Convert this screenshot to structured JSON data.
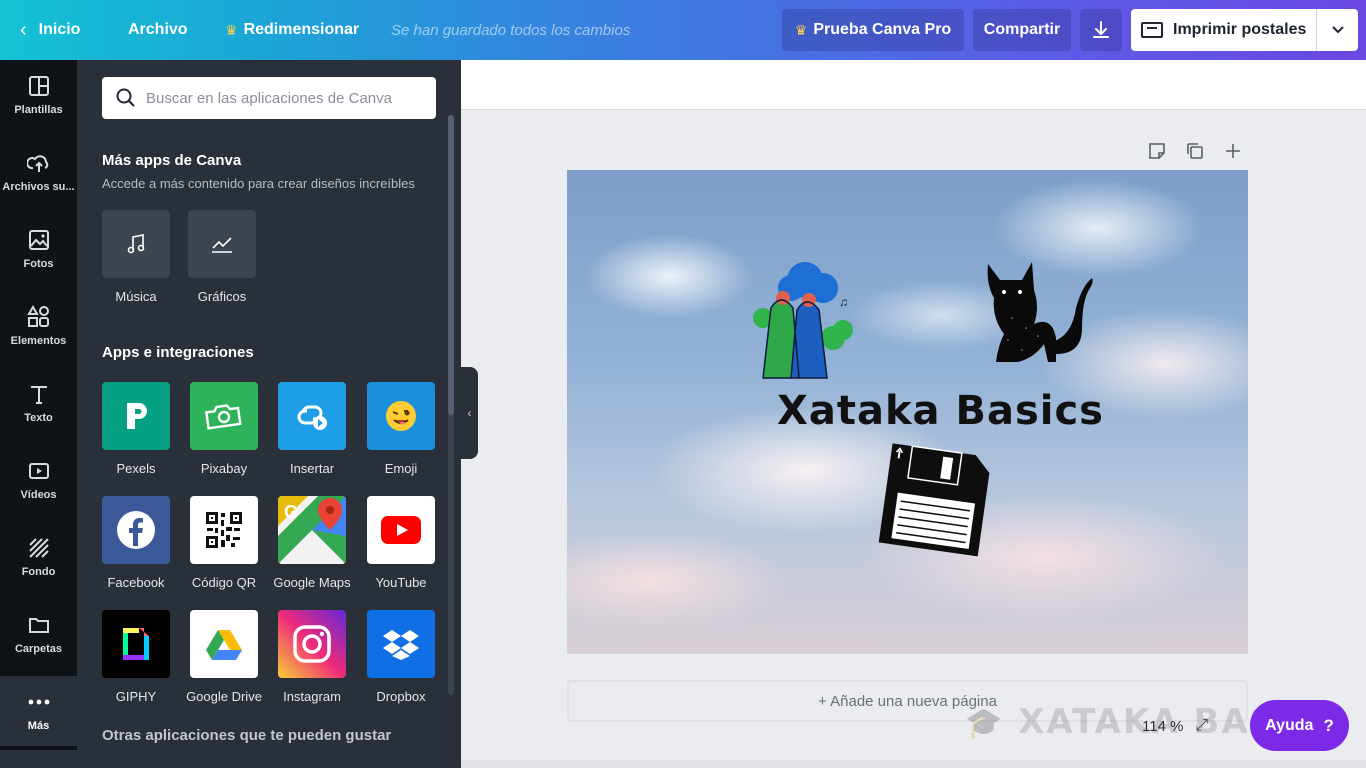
{
  "topbar": {
    "back_label": "Inicio",
    "file_label": "Archivo",
    "resize_label": "Redimensionar",
    "saved_status": "Se han guardado todos los cambios",
    "pro_label": "Prueba Canva Pro",
    "share_label": "Compartir",
    "print_label": "Imprimir postales"
  },
  "leftnav": {
    "items": [
      {
        "label": "Plantillas",
        "icon": "templates-icon"
      },
      {
        "label": "Archivos su...",
        "icon": "upload-cloud-icon"
      },
      {
        "label": "Fotos",
        "icon": "photos-icon"
      },
      {
        "label": "Elementos",
        "icon": "elements-icon"
      },
      {
        "label": "Texto",
        "icon": "text-icon"
      },
      {
        "label": "Vídeos",
        "icon": "video-icon"
      },
      {
        "label": "Fondo",
        "icon": "background-icon"
      },
      {
        "label": "Carpetas",
        "icon": "folder-icon"
      },
      {
        "label": "Más",
        "icon": "more-icon"
      }
    ]
  },
  "panel": {
    "search_placeholder": "Buscar en las aplicaciones de Canva",
    "more_apps_title": "Más apps de Canva",
    "more_apps_subtitle": "Accede a más contenido para crear diseños increíbles",
    "canva_apps": [
      {
        "label": "Música",
        "icon": "music-note-icon"
      },
      {
        "label": "Gráficos",
        "icon": "chart-line-icon"
      }
    ],
    "integrations_title": "Apps e integraciones",
    "integrations": [
      {
        "label": "Pexels",
        "icon": "pexels-icon",
        "color": "#05a081"
      },
      {
        "label": "Pixabay",
        "icon": "pixabay-icon",
        "color": "#2eb35a"
      },
      {
        "label": "Insertar",
        "icon": "embed-icon",
        "color": "#1e9ee6"
      },
      {
        "label": "Emoji",
        "icon": "emoji-icon",
        "color": "#1a8fdc"
      },
      {
        "label": "Facebook",
        "icon": "facebook-icon",
        "color": "#3b5998"
      },
      {
        "label": "Código QR",
        "icon": "qr-code-icon",
        "color": "#ffffff"
      },
      {
        "label": "Google Maps",
        "icon": "google-maps-icon",
        "color": "#ffffff"
      },
      {
        "label": "YouTube",
        "icon": "youtube-icon",
        "color": "#ffffff"
      },
      {
        "label": "GIPHY",
        "icon": "giphy-icon",
        "color": "#000000"
      },
      {
        "label": "Google Drive",
        "icon": "google-drive-icon",
        "color": "#ffffff"
      },
      {
        "label": "Instagram",
        "icon": "instagram-icon",
        "color": "#d6249f"
      },
      {
        "label": "Dropbox",
        "icon": "dropbox-icon",
        "color": "#0f6fe5"
      }
    ],
    "other_apps_title": "Otras aplicaciones que te pueden gustar"
  },
  "canvas": {
    "design_title": "Xataka Basics",
    "add_page_label": "+ Añade una nueva página",
    "zoom_level": "114 %",
    "help_label": "Ayuda",
    "help_symbol": "?",
    "watermark": "XATAKA BASICS"
  }
}
